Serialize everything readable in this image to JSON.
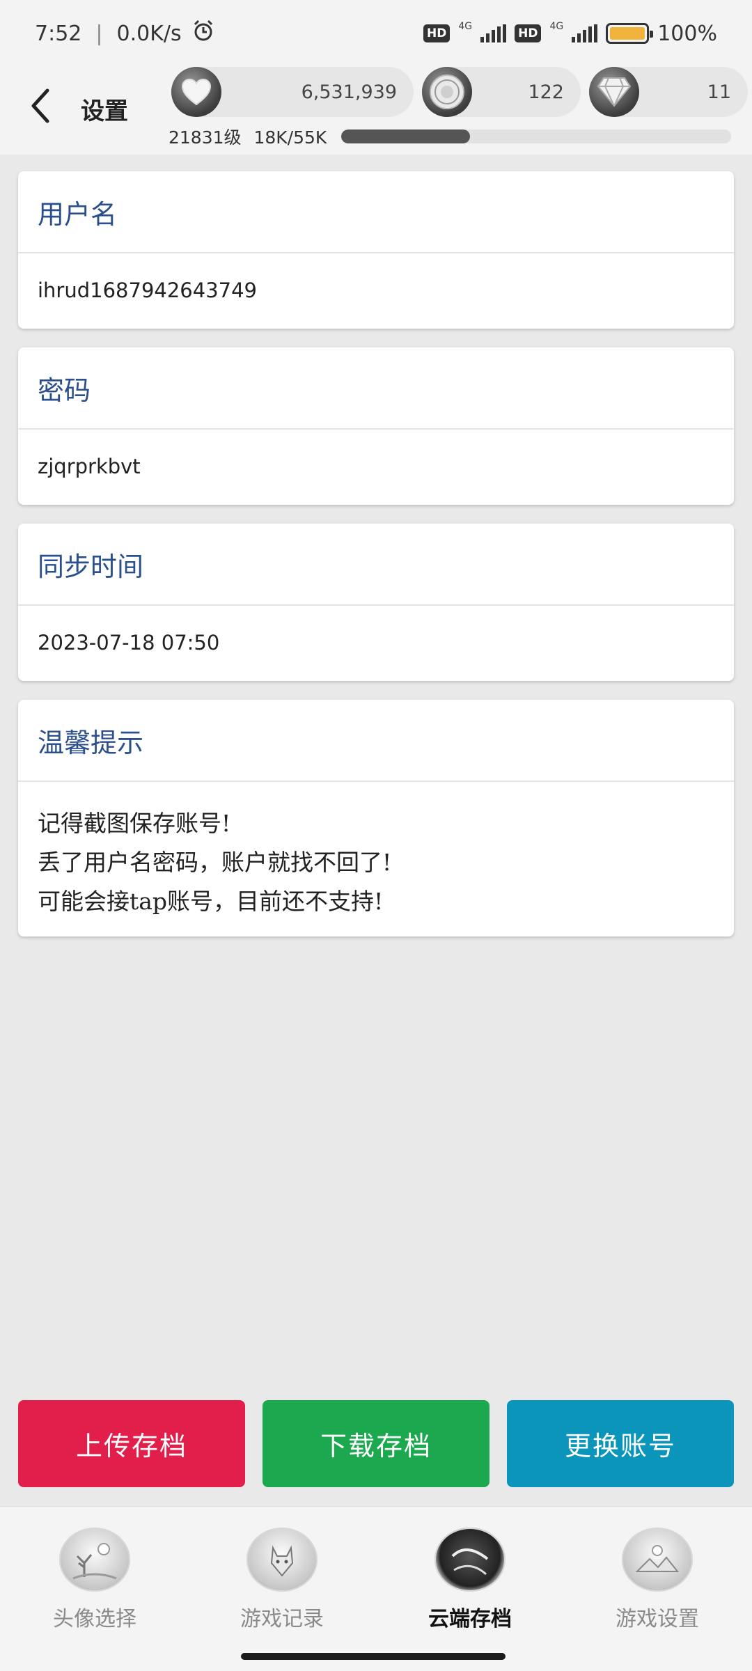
{
  "status_bar": {
    "time": "7:52",
    "speed": "0.0K/s",
    "hd1": "HD",
    "net1": "4G",
    "hd2": "HD",
    "net2": "4G",
    "battery": "100%"
  },
  "header": {
    "title": "设置",
    "hearts": "6,531,939",
    "coins": "122",
    "gems": "11",
    "level": "21831级",
    "xp": "18K/55K",
    "xp_fraction": 0.33
  },
  "cards": {
    "username": {
      "title": "用户名",
      "value": "ihrud1687942643749"
    },
    "password": {
      "title": "密码",
      "value": "zjqrprkbvt"
    },
    "sync": {
      "title": "同步时间",
      "value": "2023-07-18 07:50"
    },
    "tip": {
      "title": "温馨提示",
      "lines": [
        "记得截图保存账号!",
        "丢了用户名密码，账户就找不回了!",
        "可能会接tap账号，目前还不支持!"
      ]
    }
  },
  "actions": {
    "upload": {
      "label": "上传存档",
      "color": "#e21e4b"
    },
    "download": {
      "label": "下载存档",
      "color": "#1ba84e"
    },
    "switch": {
      "label": "更换账号",
      "color": "#0b95bb"
    }
  },
  "nav": {
    "avatar": {
      "label": "头像选择",
      "icon": "tree-moon-icon"
    },
    "history": {
      "label": "游戏记录",
      "icon": "wolf-icon"
    },
    "cloud": {
      "label": "云端存档",
      "icon": "cloud-save-icon"
    },
    "settings": {
      "label": "游戏设置",
      "icon": "landscape-icon"
    }
  },
  "colors": {
    "card_title": "#2a4f8c",
    "background": "#e9e9e9"
  }
}
